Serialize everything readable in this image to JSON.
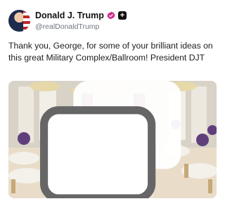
{
  "post": {
    "author": {
      "display_name": "Donald J. Trump",
      "handle": "@realDonaldTrump",
      "verified_badge_color": "#d12a8c"
    },
    "text": "Thank you, George, for some of your brilliant ideas on this great Military Complex/Ballroom! President DJT"
  },
  "icons": {
    "verified": "verified-badge-icon",
    "action": "plus-square-icon",
    "media": "gallery-icon"
  }
}
